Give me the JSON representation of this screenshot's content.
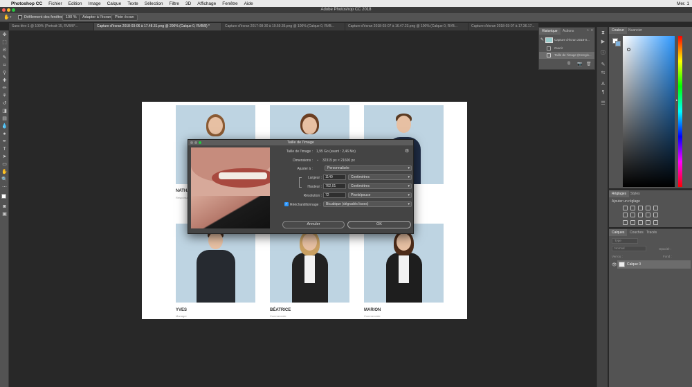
{
  "menubar": {
    "app": "Photoshop CC",
    "items": [
      "Fichier",
      "Edition",
      "Image",
      "Calque",
      "Texte",
      "Sélection",
      "Filtre",
      "3D",
      "Affichage",
      "Fenêtre",
      "Aide"
    ],
    "clock": "Mer. 1"
  },
  "window": {
    "title": "Adobe Photoshop CC 2018"
  },
  "options": {
    "scroll_all": "Défilement des fenêtres",
    "zoom": "100 %",
    "fit": "Adapter à l'écran",
    "fill": "Plein écran"
  },
  "tabs": [
    "Sans titre-1 @ 100% (Portrait-15, RVB/8*...",
    "Capture d'écran 2018-03-06 à 17.48.31.png @ 200% (Calque 0, RVB/8) *",
    "Capture d'écran 2017-08-30 à 19.59.35.png @ 100% (Calque 0, RVB...",
    "Capture d'écran 2018-03-07 à 16.47.23.png @ 100% (Calque 0, RVB...",
    "Capture d'écran 2018-03-07 à 17.36.17..."
  ],
  "document": {
    "people": [
      {
        "name": "NATHA",
        "role": "Responsa"
      },
      {
        "name": "",
        "role": ""
      },
      {
        "name": "",
        "role": ""
      },
      {
        "name": "YVES",
        "role": "Manager"
      },
      {
        "name": "BÉATRICE",
        "role": "Commerciale"
      },
      {
        "name": "MARION",
        "role": "Commerciale"
      }
    ]
  },
  "dialog": {
    "title": "Taille de l'image",
    "image_size_label": "Taille de l'image :",
    "image_size_value": "1,95 Go (avant : 2,46 Mo)",
    "dimensions_label": "Dimensions :",
    "dimensions_value": "32315 px  ×  21600 px",
    "fit_label": "Ajuster à :",
    "fit_value": "Personnalisée",
    "width_label": "Largeur :",
    "width_value": "1140",
    "width_unit": "Centimètres",
    "height_label": "Hauteur :",
    "height_value": "762,01",
    "height_unit": "Centimètres",
    "resolution_label": "Résolution :",
    "resolution_value": "72",
    "resolution_unit": "Pixels/pouce",
    "resample_label": "Rééchantillonnage :",
    "resample_checked": true,
    "resample_value": "Bicubique (dégradés lisses)",
    "cancel": "Annuler",
    "ok": "OK"
  },
  "history": {
    "tab_history": "Historique",
    "tab_actions": "Actions",
    "items": [
      "Capture d'écran 2018-0...",
      "Ouvrir",
      "Taille de l'image (Enregis..."
    ]
  },
  "color": {
    "tab_color": "Couleur",
    "tab_swatches": "Nuancier"
  },
  "adjustments": {
    "tab_adjust": "Réglages",
    "tab_styles": "Styles",
    "add": "Ajouter un réglage"
  },
  "layers": {
    "tab_layers": "Calques",
    "tab_channels": "Couches",
    "tab_paths": "Tracés",
    "kind": "Type",
    "blend": "Normal",
    "opacity_label": "Opacité :",
    "lock_label": "Verrou :",
    "fill_label": "Fond :",
    "layer_name": "Calque 0"
  },
  "colors": {
    "accent": "#2d98ff",
    "bg": "#282828",
    "panel": "#535353"
  }
}
